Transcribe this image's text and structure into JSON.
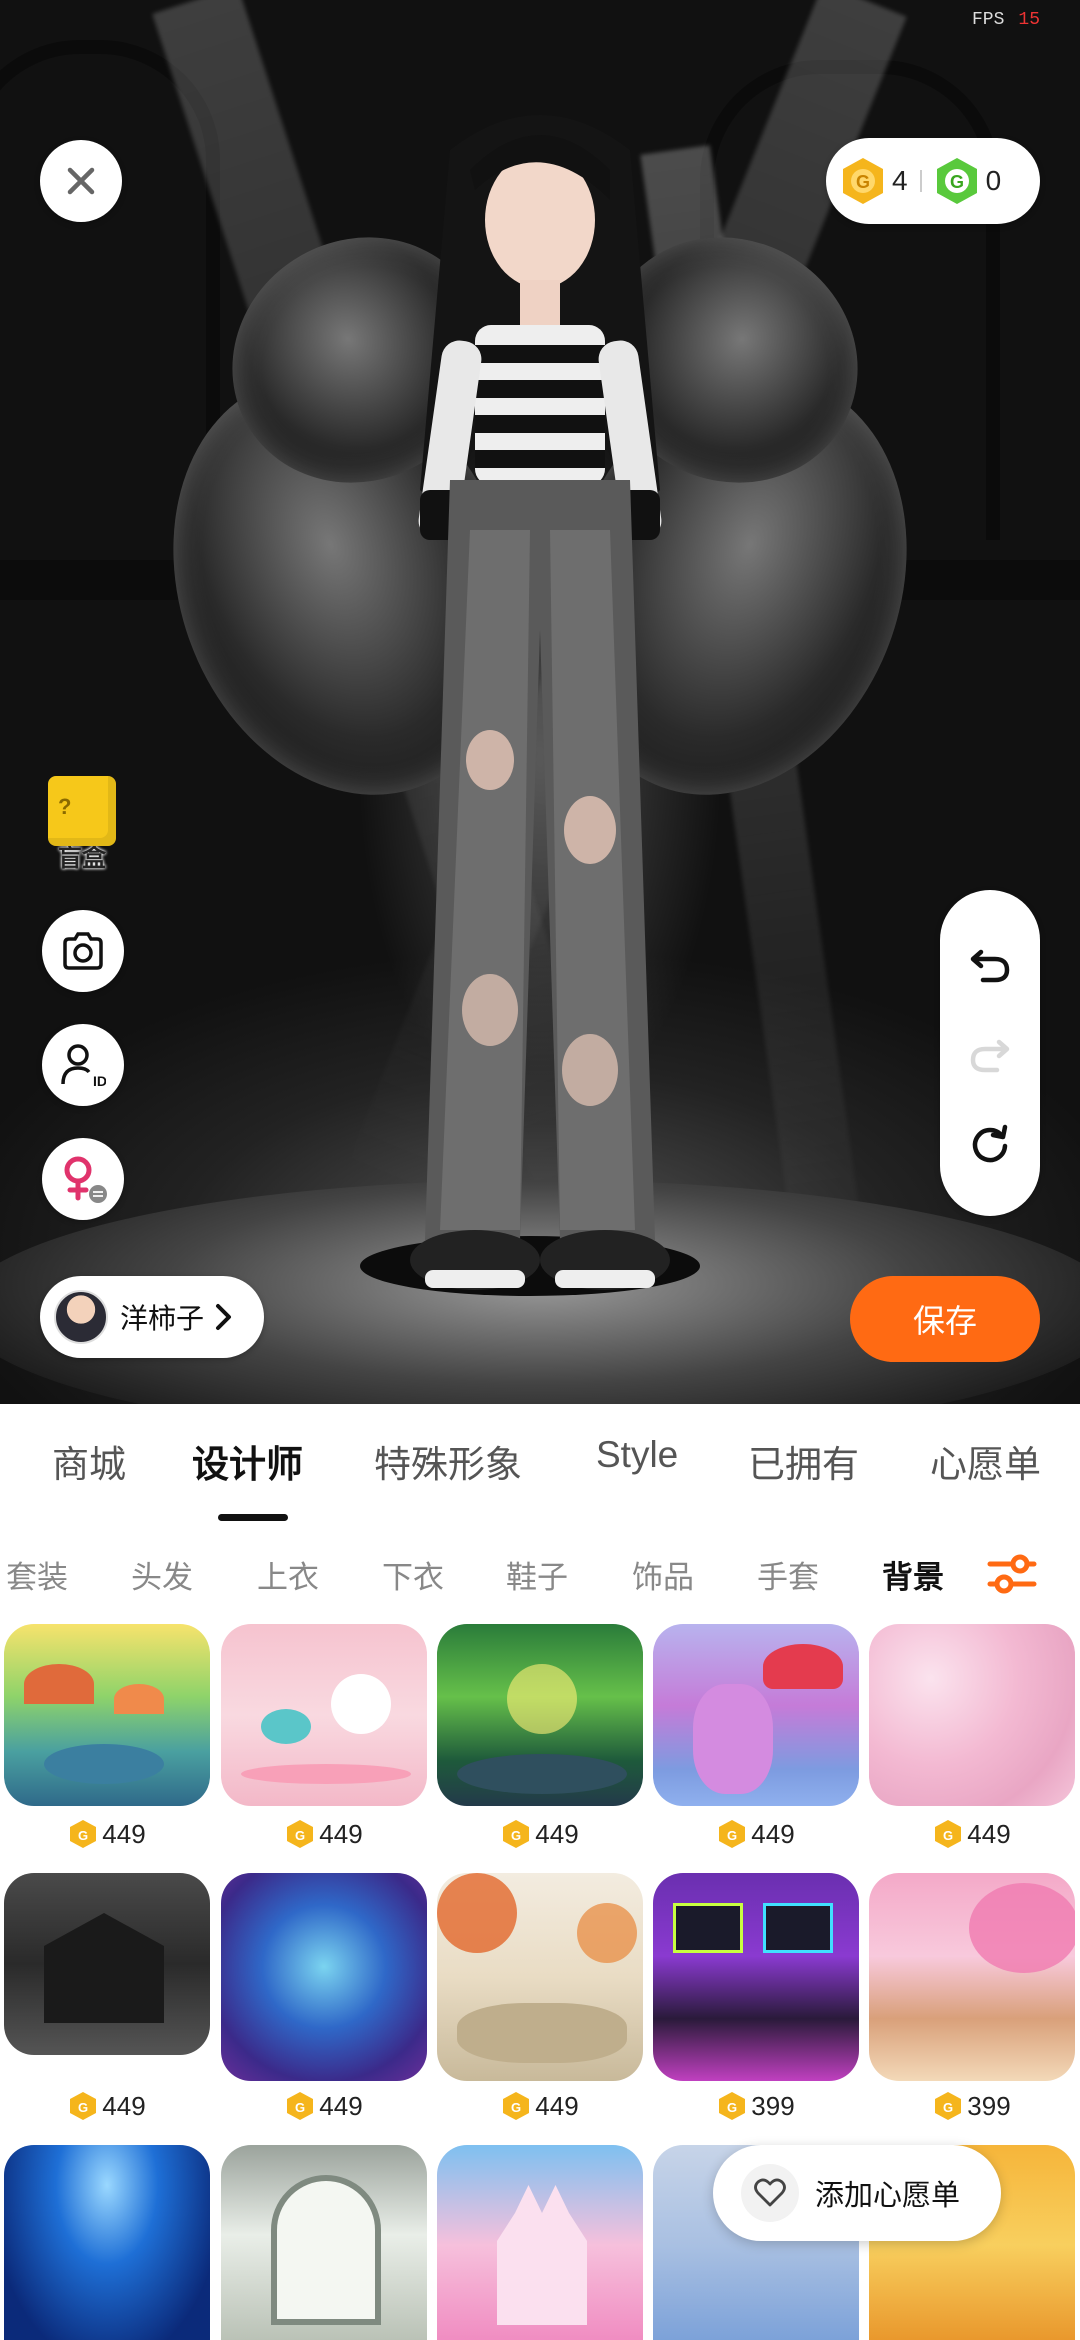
{
  "status": {
    "fps_label": "FPS",
    "fps_value": "15"
  },
  "currency": {
    "gold_icon": "gold-coin-icon",
    "gold_value": "4",
    "green_icon": "green-coin-icon",
    "green_value": "0"
  },
  "left_tools": {
    "blind_box_label": "盲盒",
    "close_icon": "close-icon",
    "camera_icon": "camera-icon",
    "profile_id_icon": "profile-id-icon",
    "gender_switch_icon": "female-switch-icon"
  },
  "right_tools": {
    "undo_icon": "undo-icon",
    "redo_icon": "redo-icon",
    "reset_icon": "refresh-icon"
  },
  "user": {
    "name": "洋柿子"
  },
  "save_label": "保存",
  "main_tabs": [
    "商城",
    "设计师",
    "特殊形象",
    "Style",
    "已拥有",
    "心愿单"
  ],
  "main_tab_active": "设计师",
  "sub_tabs": [
    "套装",
    "头发",
    "上衣",
    "下衣",
    "鞋子",
    "饰品",
    "手套",
    "背景"
  ],
  "sub_tab_active": "背景",
  "items": [
    {
      "price": "449",
      "theme": "mushroom-forest"
    },
    {
      "price": "449",
      "theme": "pink-toy-room"
    },
    {
      "price": "449",
      "theme": "green-jungle"
    },
    {
      "price": "449",
      "theme": "purple-mushroom-island"
    },
    {
      "price": "449",
      "theme": "pink-clouds"
    },
    {
      "price": "449",
      "theme": "haunted-house"
    },
    {
      "price": "449",
      "theme": "underwater-cave"
    },
    {
      "price": "449",
      "theme": "autumn-canyon"
    },
    {
      "price": "399",
      "theme": "gaming-room"
    },
    {
      "price": "399",
      "theme": "sakura-street"
    },
    {
      "price": "",
      "theme": "blue-stage"
    },
    {
      "price": "",
      "theme": "white-window-room"
    },
    {
      "price": "",
      "theme": "pink-castle"
    },
    {
      "price": "",
      "theme": "blue-frame-room"
    },
    {
      "price": "",
      "theme": "honey-room"
    }
  ],
  "wishlist_label": "添加心愿单"
}
